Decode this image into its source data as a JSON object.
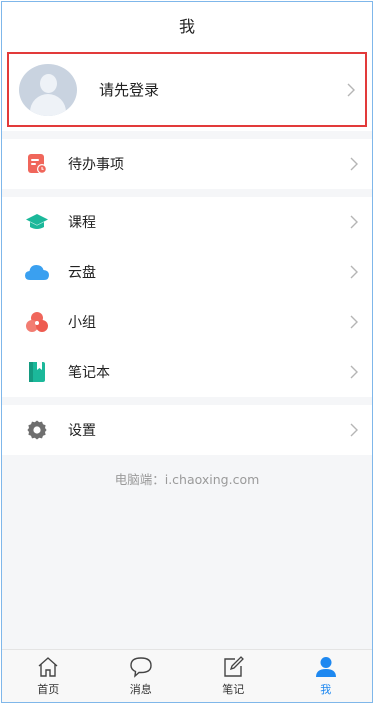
{
  "header": {
    "title": "我"
  },
  "profile": {
    "login_text": "请先登录",
    "avatar_icon": "user-avatar-placeholder"
  },
  "sections": {
    "todo": {
      "label": "待办事项",
      "icon": "todo-icon",
      "color": "#f0665b"
    },
    "courses": {
      "label": "课程",
      "icon": "graduation-cap-icon",
      "color": "#1bb89a"
    },
    "cloud": {
      "label": "云盘",
      "icon": "cloud-icon",
      "color": "#3aa0f0"
    },
    "group": {
      "label": "小组",
      "icon": "group-icon",
      "color": "#f0665b"
    },
    "notebook": {
      "label": "笔记本",
      "icon": "notebook-icon",
      "color": "#1bb89a"
    },
    "settings": {
      "label": "设置",
      "icon": "gear-icon",
      "color": "#777777"
    }
  },
  "footer": {
    "pc_link": "电脑端：i.chaoxing.com"
  },
  "tabbar": {
    "home": "首页",
    "messages": "消息",
    "notes": "笔记",
    "me": "我",
    "active_color": "#1e88f0"
  }
}
